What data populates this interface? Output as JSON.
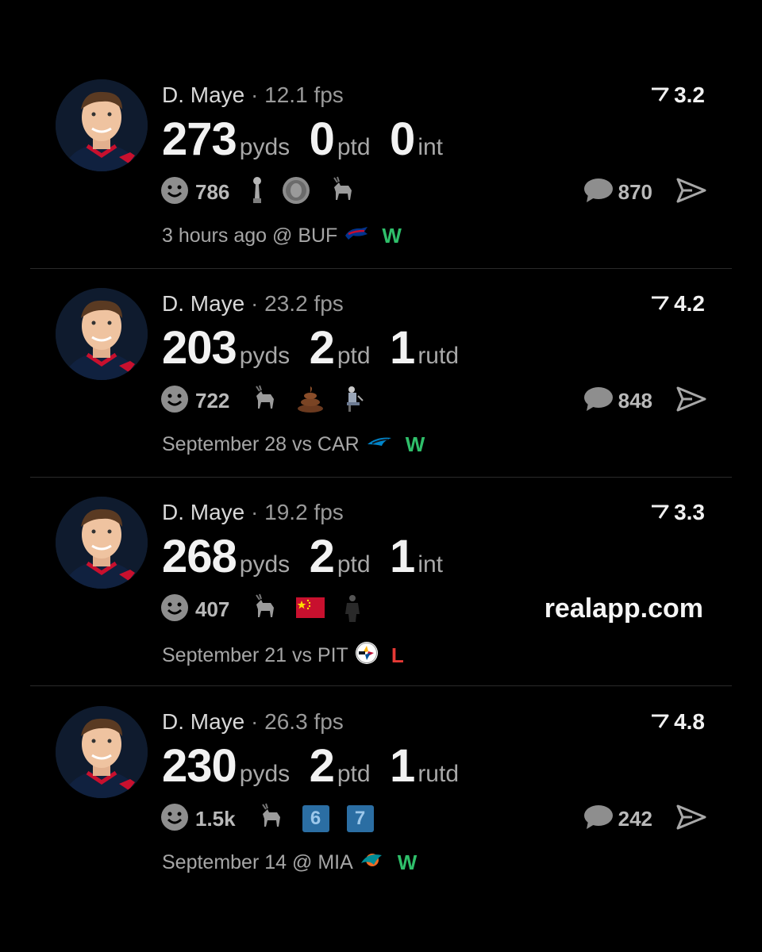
{
  "watermark": "realapp.com",
  "colors": {
    "win": "#2fbf6a",
    "loss": "#e53935",
    "background": "#000000"
  },
  "posts": [
    {
      "player": "D. Maye",
      "fps": "12.1 fps",
      "rating": "3.2",
      "stats": [
        {
          "value": "273",
          "unit": "pyds"
        },
        {
          "value": "0",
          "unit": "ptd"
        },
        {
          "value": "0",
          "unit": "int"
        }
      ],
      "react_count": "786",
      "emojis": [
        "trophy-icon",
        "coin-face-icon",
        "goat-icon"
      ],
      "comment_count": "870",
      "date": "3 hours ago @ BUF",
      "opponent_logo": "bills-logo",
      "result": "W"
    },
    {
      "player": "D. Maye",
      "fps": "23.2 fps",
      "rating": "4.2",
      "stats": [
        {
          "value": "203",
          "unit": "pyds"
        },
        {
          "value": "2",
          "unit": "ptd"
        },
        {
          "value": "1",
          "unit": "rutd"
        }
      ],
      "react_count": "722",
      "emojis": [
        "goat-icon",
        "poop-icon",
        "person-sitting-icon"
      ],
      "comment_count": "848",
      "date": "September 28 vs CAR",
      "opponent_logo": "panthers-logo",
      "result": "W"
    },
    {
      "player": "D. Maye",
      "fps": "19.2 fps",
      "rating": "3.3",
      "stats": [
        {
          "value": "268",
          "unit": "pyds"
        },
        {
          "value": "2",
          "unit": "ptd"
        },
        {
          "value": "1",
          "unit": "int"
        }
      ],
      "react_count": "407",
      "emojis": [
        "goat-icon",
        "china-flag-icon",
        "person-standing-icon"
      ],
      "comment_count": "",
      "date": "September 21 vs PIT",
      "opponent_logo": "steelers-logo",
      "result": "L"
    },
    {
      "player": "D. Maye",
      "fps": "26.3 fps",
      "rating": "4.8",
      "stats": [
        {
          "value": "230",
          "unit": "pyds"
        },
        {
          "value": "2",
          "unit": "ptd"
        },
        {
          "value": "1",
          "unit": "rutd"
        }
      ],
      "react_count": "1.5k",
      "emojis": [
        "goat-icon",
        "six-tile-icon",
        "seven-tile-icon"
      ],
      "emoji_text": {
        "six": "6",
        "seven": "7"
      },
      "comment_count": "242",
      "date": "September 14 @ MIA",
      "opponent_logo": "dolphins-logo",
      "result": "W"
    }
  ]
}
